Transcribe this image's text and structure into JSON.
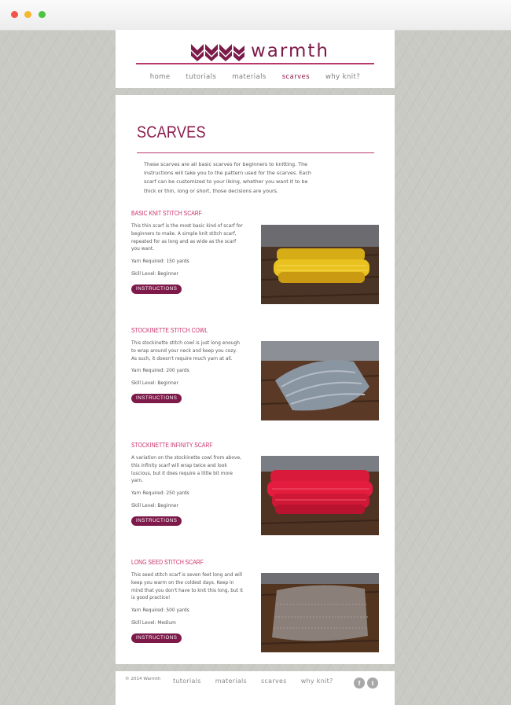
{
  "brand": {
    "name": "warmth",
    "logo_icon": "zigzag-knit-icon",
    "accent_color": "#8a1c4b",
    "highlight_color": "#c9316a"
  },
  "nav": {
    "items": [
      "home",
      "tutorials",
      "materials",
      "scarves",
      "why knit?"
    ],
    "active": "scarves"
  },
  "page": {
    "title": "SCARVES",
    "intro": "These scarves are all basic scarves for beginners to knitting. The instructions will take you to the pattern used for the scarves. Each scarf can be customized to your liking, whether you want it to be thick or thin, long or short, those decisions are yours."
  },
  "scarves": [
    {
      "title": "BASIC KNIT STITCH SCARF",
      "description": "This thin scarf is the most basic kind of scarf for beginners to make. A simple knit stitch scarf, repeated for as long and as wide as the scarf you want.",
      "yarn": "Yarn Required: 150 yards",
      "skill": "Skill Level: Beginner",
      "button": "INSTRUCTIONS",
      "image_color": "#e9c21f"
    },
    {
      "title": "STOCKINETTE STITCH COWL",
      "description": "This stockinette stitch cowl is just long enough to wrap around your neck and keep you cozy. As such, it doesn't require much yarn at all.",
      "yarn": "Yarn Required: 200 yards",
      "skill": "Skill Level: Beginner",
      "button": "INSTRUCTIONS",
      "image_color": "#8a95a2"
    },
    {
      "title": "STOCKINETTE INFINITY SCARF",
      "description": "A variation on the stockinette cowl from above, this infinity scarf will wrap twice and look luscious, but it does require a little bit more yarn.",
      "yarn": "Yarn Required: 250 yards",
      "skill": "Skill Level: Beginner",
      "button": "INSTRUCTIONS",
      "image_color": "#e41d3f"
    },
    {
      "title": "LONG SEED STITCH SCARF",
      "description": "This seed stitch scarf is seven feet long and will keep you warm on the coldest days. Keep in mind that you don't have to knit this long, but it is good practice!",
      "yarn": "Yarn Required: 500 yards",
      "skill": "Skill Level: Medium",
      "button": "INSTRUCTIONS",
      "image_color": "#8b8079"
    }
  ],
  "footer": {
    "copyright": "© 2014 Warmth",
    "nav": [
      "tutorials",
      "materials",
      "scarves",
      "why knit?"
    ],
    "social": [
      {
        "icon": "facebook-icon",
        "glyph": "f"
      },
      {
        "icon": "twitter-icon",
        "glyph": "t"
      }
    ]
  }
}
